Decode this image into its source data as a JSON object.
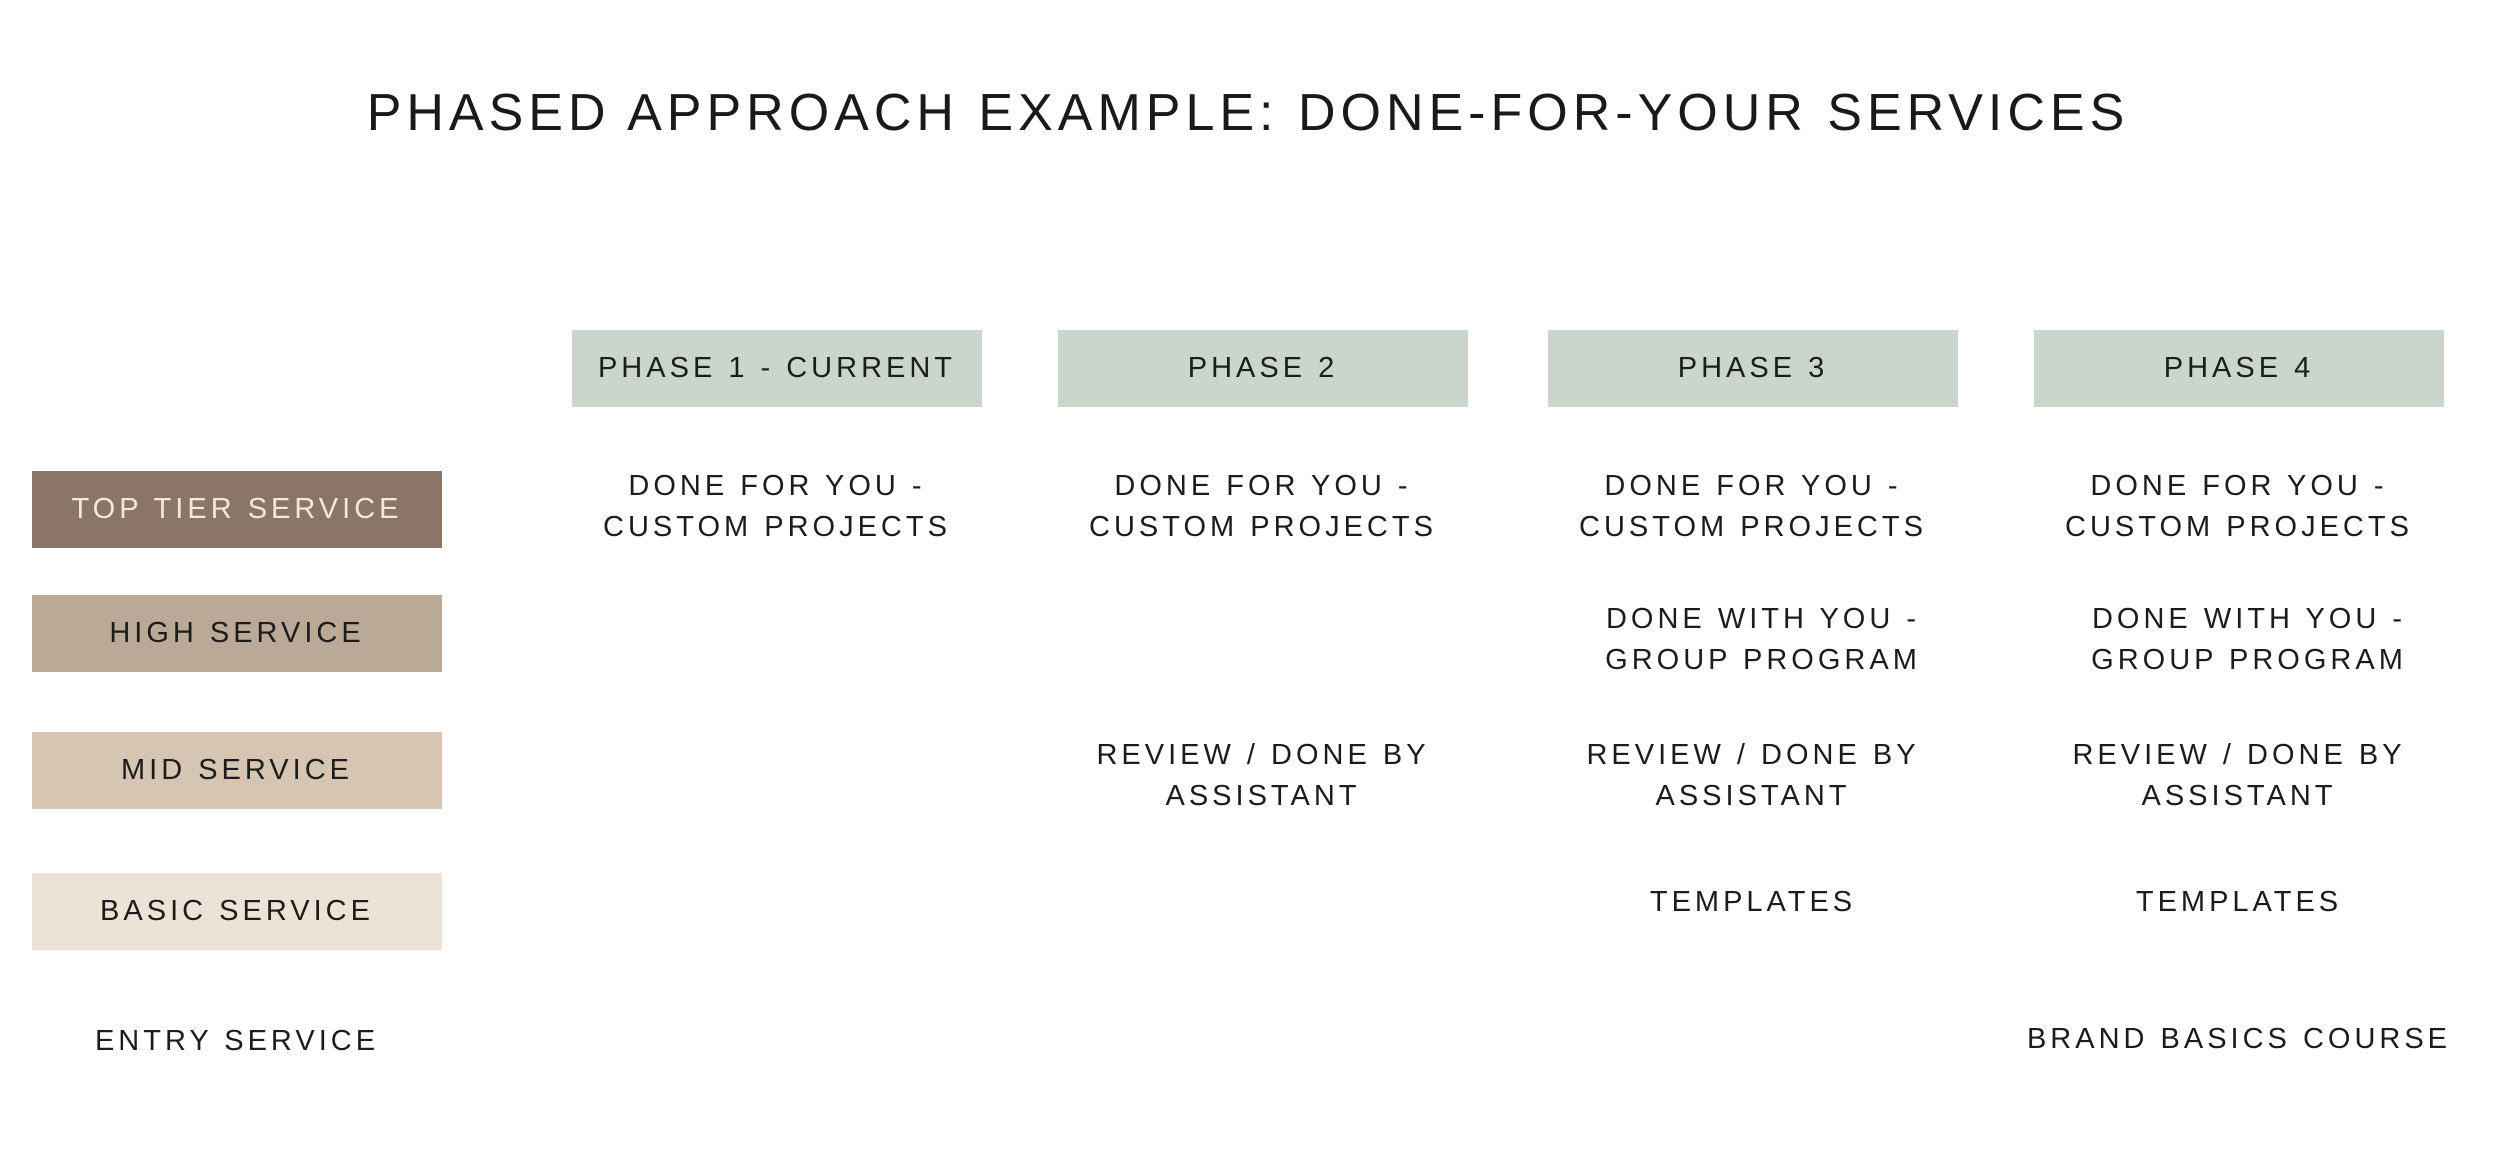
{
  "title": "PHASED APPROACH EXAMPLE:  DONE-FOR-YOUR SERVICES",
  "phases": [
    {
      "label": "PHASE 1 - CURRENT"
    },
    {
      "label": "PHASE 2"
    },
    {
      "label": "PHASE 3"
    },
    {
      "label": "PHASE 4"
    }
  ],
  "tiers": [
    {
      "label": "TOP TIER SERVICE",
      "color": "#8a7567",
      "text_color": "#f0e8df"
    },
    {
      "label": "HIGH SERVICE",
      "color": "#b9a996",
      "text_color": "#1c1c1c"
    },
    {
      "label": "MID SERVICE",
      "color": "#d5c5b2",
      "text_color": "#1c1c1c"
    },
    {
      "label": "BASIC SERVICE",
      "color": "#ede2d6",
      "text_color": "#1c1c1c"
    },
    {
      "label": "ENTRY SERVICE",
      "color": null,
      "text_color": "#1c1c1c"
    }
  ],
  "phase_header_color": "#cad6cb",
  "grid": {
    "top_tier": {
      "phase1": [
        "DONE FOR YOU -",
        "CUSTOM PROJECTS"
      ],
      "phase2": [
        "DONE FOR YOU -",
        "CUSTOM PROJECTS"
      ],
      "phase3": [
        "DONE FOR YOU -",
        "CUSTOM PROJECTS"
      ],
      "phase4": [
        "DONE FOR YOU -",
        "CUSTOM PROJECTS"
      ]
    },
    "high": {
      "phase3": [
        "DONE WITH YOU -",
        "GROUP PROGRAM"
      ],
      "phase4": [
        "DONE WITH YOU -",
        "GROUP PROGRAM"
      ]
    },
    "mid": {
      "phase2": [
        "REVIEW / DONE BY",
        "ASSISTANT"
      ],
      "phase3": [
        "REVIEW / DONE BY",
        "ASSISTANT"
      ],
      "phase4": [
        "REVIEW / DONE BY",
        "ASSISTANT"
      ]
    },
    "basic": {
      "phase3": [
        "TEMPLATES"
      ],
      "phase4": [
        "TEMPLATES"
      ]
    },
    "entry": {
      "phase4": [
        "BRAND BASICS COURSE"
      ]
    }
  }
}
